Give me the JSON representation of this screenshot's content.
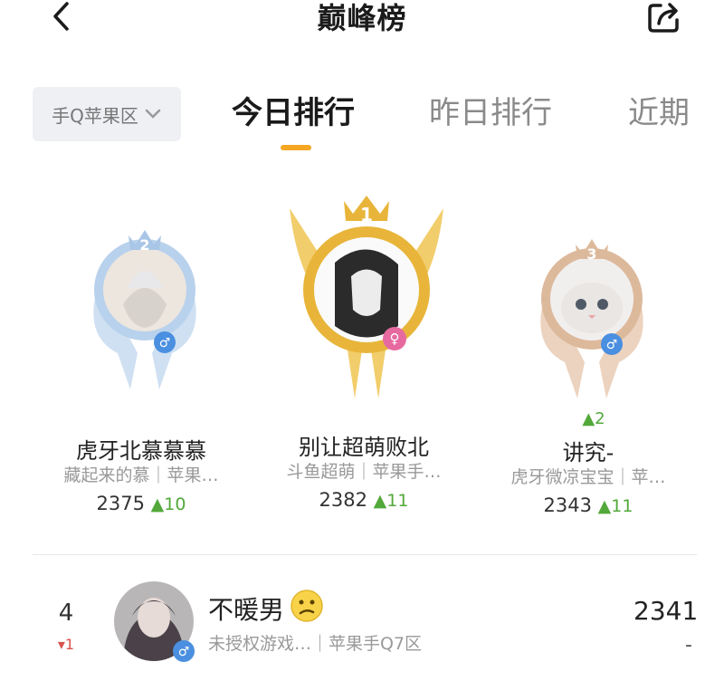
{
  "header": {
    "title": "巅峰榜",
    "back_icon": "chevron-left-icon",
    "share_icon": "share-icon"
  },
  "region": {
    "label": "手Q苹果区"
  },
  "tabs": [
    {
      "label": "今日排行",
      "active": true
    },
    {
      "label": "昨日排行",
      "active": false
    },
    {
      "label": "近期"
    }
  ],
  "podium": [
    {
      "rank": "1",
      "name": "别让超萌败北",
      "sub": "斗鱼超萌｜苹果手…",
      "score": "2382",
      "change": "▲11",
      "gender": "♀",
      "color": "#e8b53a"
    },
    {
      "rank": "2",
      "name": "虎牙北慕慕慕",
      "sub": "藏起来的慕｜苹果…",
      "score": "2375",
      "change": "▲10",
      "gender": "♂",
      "color": "#a9c6e6"
    },
    {
      "rank": "3",
      "name": "讲究-",
      "sub": "虎牙微凉宝宝｜苹…",
      "score": "2343",
      "change": "▲11",
      "rank_change": "▲2",
      "gender": "♂",
      "color": "#ddb99c"
    }
  ],
  "rows": [
    {
      "rank": "4",
      "change": "▾1",
      "name": "不暖男",
      "sub": "未授权游戏…｜苹果手Q7区",
      "score": "2341",
      "trend": "-",
      "gender": "♂"
    }
  ],
  "colors": {
    "accent": "#f5a623",
    "up": "#52a83a",
    "down": "#d9534f",
    "male": "#4a8fe0",
    "female": "#e66aa0"
  }
}
